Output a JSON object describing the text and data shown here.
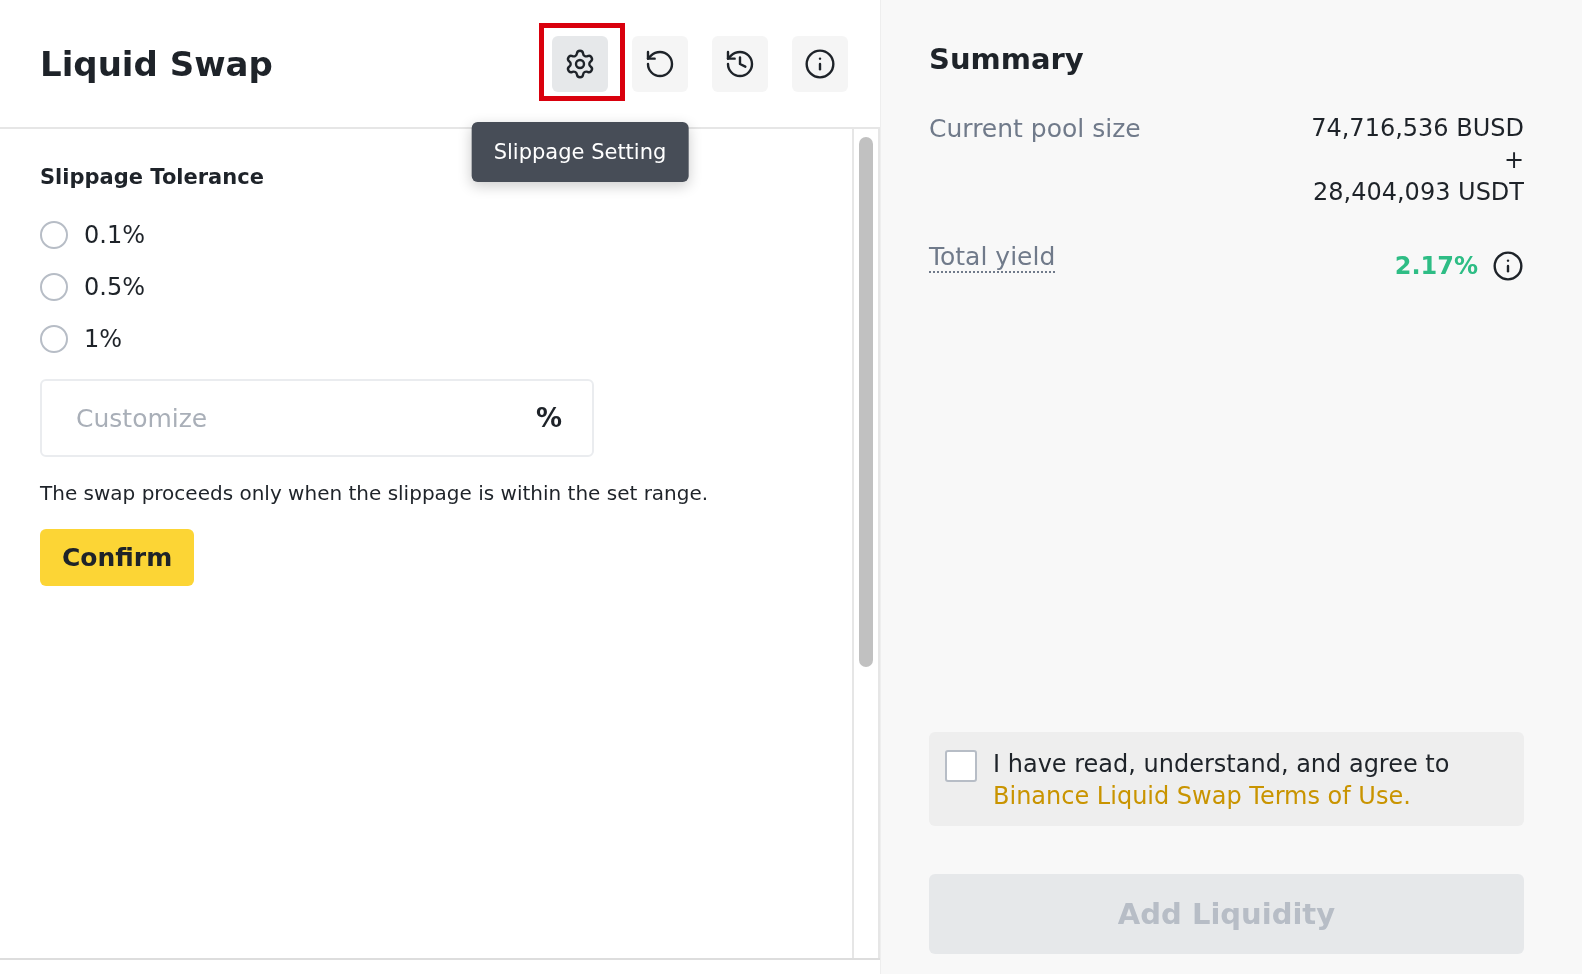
{
  "title": "Liquid Swap",
  "toolbar": [
    {
      "kind": "settings",
      "highlighted": true
    },
    {
      "kind": "reset",
      "highlighted": false
    },
    {
      "kind": "history",
      "highlighted": false
    },
    {
      "kind": "info",
      "highlighted": false
    }
  ],
  "tooltip": "Slippage Setting",
  "slippage": {
    "title": "Slippage Tolerance",
    "options": [
      {
        "label": "0.1%",
        "selected": false
      },
      {
        "label": "0.5%",
        "selected": false
      },
      {
        "label": "1%",
        "selected": false
      }
    ],
    "customize": {
      "placeholder": "Customize",
      "unit": "%"
    },
    "note": "The swap proceeds only when the slippage is within the set range.",
    "confirm": "Confirm"
  },
  "summary": {
    "title": "Summary",
    "pool_label": "Current pool size",
    "pool_values": [
      "74,716,536 BUSD",
      "+",
      "28,404,093 USDT"
    ],
    "yield_label": "Total yield",
    "yield_value": "2.17%"
  },
  "agreement": {
    "checked": false,
    "text": "I have read, understand, and agree to",
    "link": "Binance Liquid Swap Terms of Use."
  },
  "add_liquidity": {
    "label": "Add Liquidity",
    "disabled": true
  }
}
